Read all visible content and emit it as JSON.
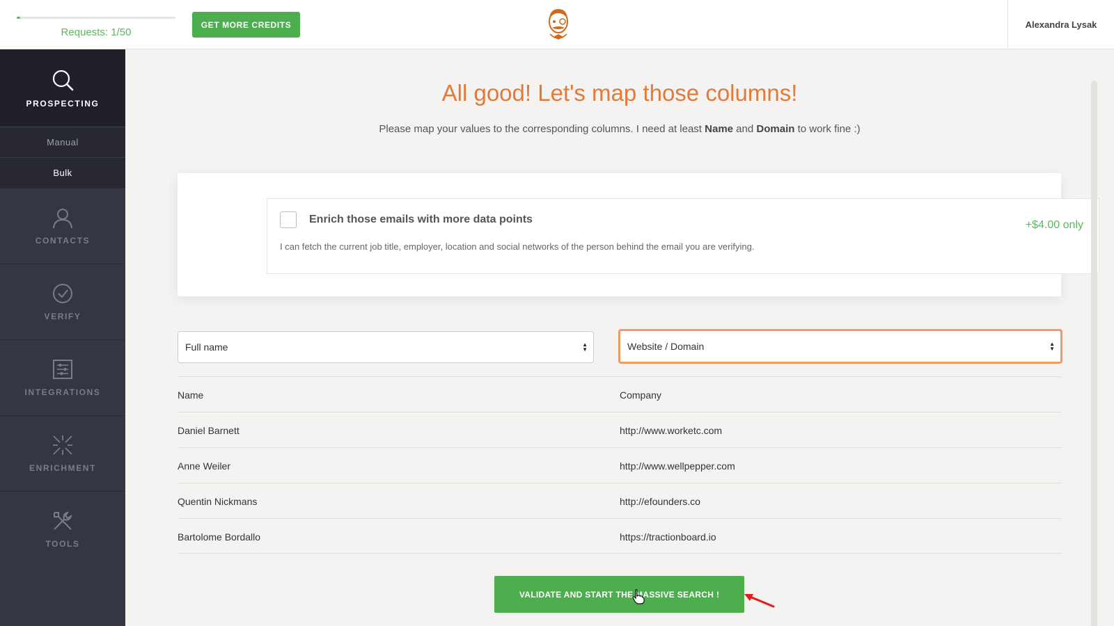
{
  "header": {
    "requests_label": "Requests: 1/50",
    "requests_used": 1,
    "requests_total": 50,
    "credits_button": "GET MORE CREDITS",
    "user_name": "Alexandra Lysak"
  },
  "sidebar": {
    "prospecting": "PROSPECTING",
    "sub_items": [
      "Manual",
      "Bulk"
    ],
    "active_sub": "Bulk",
    "items": [
      {
        "label": "CONTACTS",
        "icon": "user-icon"
      },
      {
        "label": "VERIFY",
        "icon": "check-circle-icon"
      },
      {
        "label": "INTEGRATIONS",
        "icon": "sliders-icon"
      },
      {
        "label": "ENRICHMENT",
        "icon": "arrows-in-icon"
      },
      {
        "label": "TOOLS",
        "icon": "tools-icon"
      }
    ]
  },
  "main": {
    "title": "All good! Let's map those columns!",
    "subtitle_prefix": "Please map your values to the corresponding columns. I need at least ",
    "subtitle_name": "Name",
    "subtitle_and": " and ",
    "subtitle_domain": "Domain",
    "subtitle_suffix": " to work fine :)",
    "enrich": {
      "title": "Enrich those emails with more data points",
      "description": "I can fetch the current job title, employer, location and social networks of the person behind the email you are verifying.",
      "price": "+$4.00 only",
      "checked": false
    },
    "selects": {
      "left": "Full name",
      "right": "Website / Domain"
    },
    "table": {
      "headers": [
        "Name",
        "Company"
      ],
      "rows": [
        [
          "Daniel Barnett",
          "http://www.worketc.com"
        ],
        [
          "Anne Weiler",
          "http://www.wellpepper.com"
        ],
        [
          "Quentin Nickmans",
          "http://efounders.co"
        ],
        [
          "Bartolome Bordallo",
          "https://tractionboard.io"
        ]
      ]
    },
    "validate_button": "VALIDATE AND START THE MASSIVE SEARCH !"
  },
  "colors": {
    "accent_green": "#4cae4c",
    "title_orange": "#e07b39",
    "sidebar_bg": "#343641"
  }
}
